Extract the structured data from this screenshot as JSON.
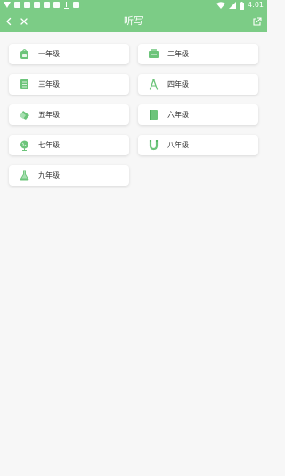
{
  "status_bar": {
    "time": "4:01"
  },
  "header": {
    "title": "听写"
  },
  "grades": [
    {
      "label": "一年级",
      "icon": "backpack-icon"
    },
    {
      "label": "二年级",
      "icon": "chalkboard-icon"
    },
    {
      "label": "三年级",
      "icon": "book-icon"
    },
    {
      "label": "四年级",
      "icon": "compass-icon"
    },
    {
      "label": "五年级",
      "icon": "eraser-icon"
    },
    {
      "label": "六年级",
      "icon": "notebook-icon"
    },
    {
      "label": "七年级",
      "icon": "globe-icon"
    },
    {
      "label": "八年级",
      "icon": "magnet-icon"
    },
    {
      "label": "九年级",
      "icon": "flask-icon"
    }
  ],
  "colors": {
    "primary": "#7ccc86",
    "card": "#ffffff",
    "icon": "#6cc47a"
  }
}
